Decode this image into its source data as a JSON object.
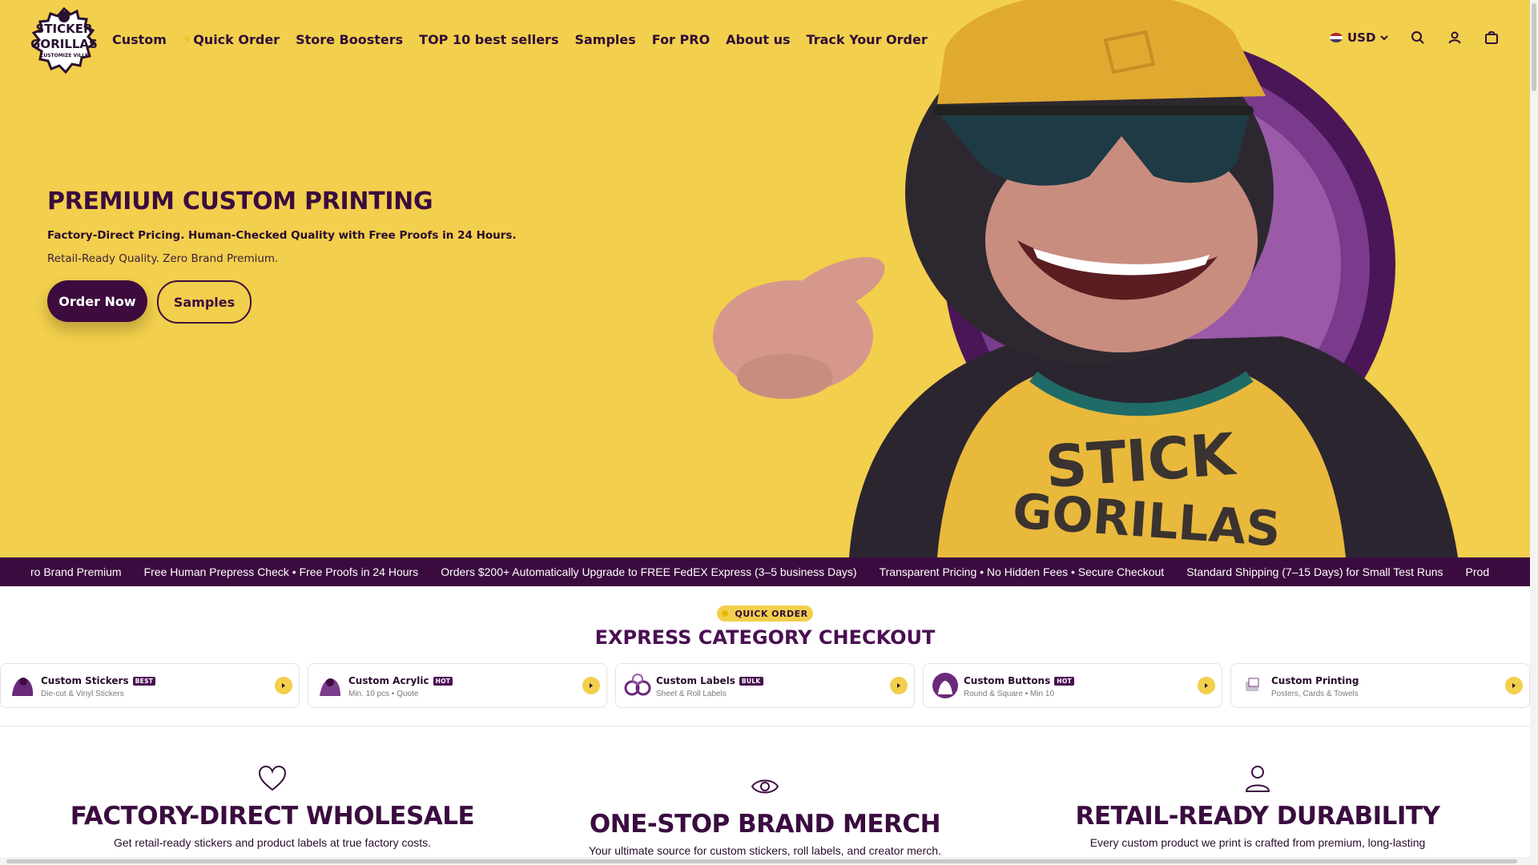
{
  "header": {
    "logo_text_top": "STICKER",
    "logo_text_mid": "GORILLAS",
    "logo_text_bottom": "CUSTOMIZE VILLE",
    "nav": [
      "Custom",
      "Quick Order",
      "Store Boosters",
      "TOP 10 best sellers",
      "Samples",
      "For PRO",
      "About us",
      "Track Your Order"
    ],
    "quick_order_icon": "bolt-icon",
    "currency": "USD",
    "icons": [
      "search-icon",
      "account-icon",
      "cart-icon"
    ]
  },
  "hero": {
    "title": "PREMIUM CUSTOM PRINTING",
    "subtitle": "Factory-Direct Pricing. Human-Checked Quality with Free Proofs in 24 Hours.",
    "tagline": "Retail-Ready Quality. Zero Brand Premium.",
    "order_button": "Order Now",
    "samples_button": "Samples",
    "shirt_line1": "STICK",
    "shirt_line2": "GORILLAS"
  },
  "marquee": [
    "ro Brand Premium",
    "Free Human Prepress Check • Free Proofs in 24 Hours",
    "Orders $200+ Automatically Upgrade to FREE FedEX Express (3–5 business Days)",
    "Transparent Pricing • No Hidden Fees • Secure Checkout",
    "Standard Shipping (7–15 Days) for Small Test Runs",
    "Prod"
  ],
  "express": {
    "pill": "QUICK ORDER",
    "title": "EXPRESS CATEGORY CHECKOUT",
    "cards": [
      {
        "name": "Custom Stickers",
        "badge": "BEST",
        "desc": "Die-cut & Vinyl Stickers"
      },
      {
        "name": "Custom Acrylic",
        "badge": "HOT",
        "desc": "Min. 10 pcs • Quote"
      },
      {
        "name": "Custom Labels",
        "badge": "BULK",
        "desc": "Sheet & Roll Labels"
      },
      {
        "name": "Custom Buttons",
        "badge": "HOT",
        "desc": "Round & Square • Min 10"
      },
      {
        "name": "Custom Printing",
        "badge": "",
        "desc": "Posters, Cards & Towels"
      }
    ]
  },
  "features": [
    {
      "icon": "heart-icon",
      "title": "FACTORY-DIRECT WHOLESALE",
      "text": "Get retail-ready stickers and product labels at true factory costs."
    },
    {
      "icon": "eye-icon",
      "title": "ONE-STOP BRAND MERCH",
      "text": "Your ultimate source for custom stickers, roll labels, and creator merch."
    },
    {
      "icon": "user-icon",
      "title": "RETAIL-READY DURABILITY",
      "text": "Every custom product we print is crafted from premium, long-lasting"
    }
  ],
  "colors": {
    "brand_yellow": "#f2cf4c",
    "brand_purple": "#3b0b3f",
    "text_dark": "#2a0b2e"
  }
}
